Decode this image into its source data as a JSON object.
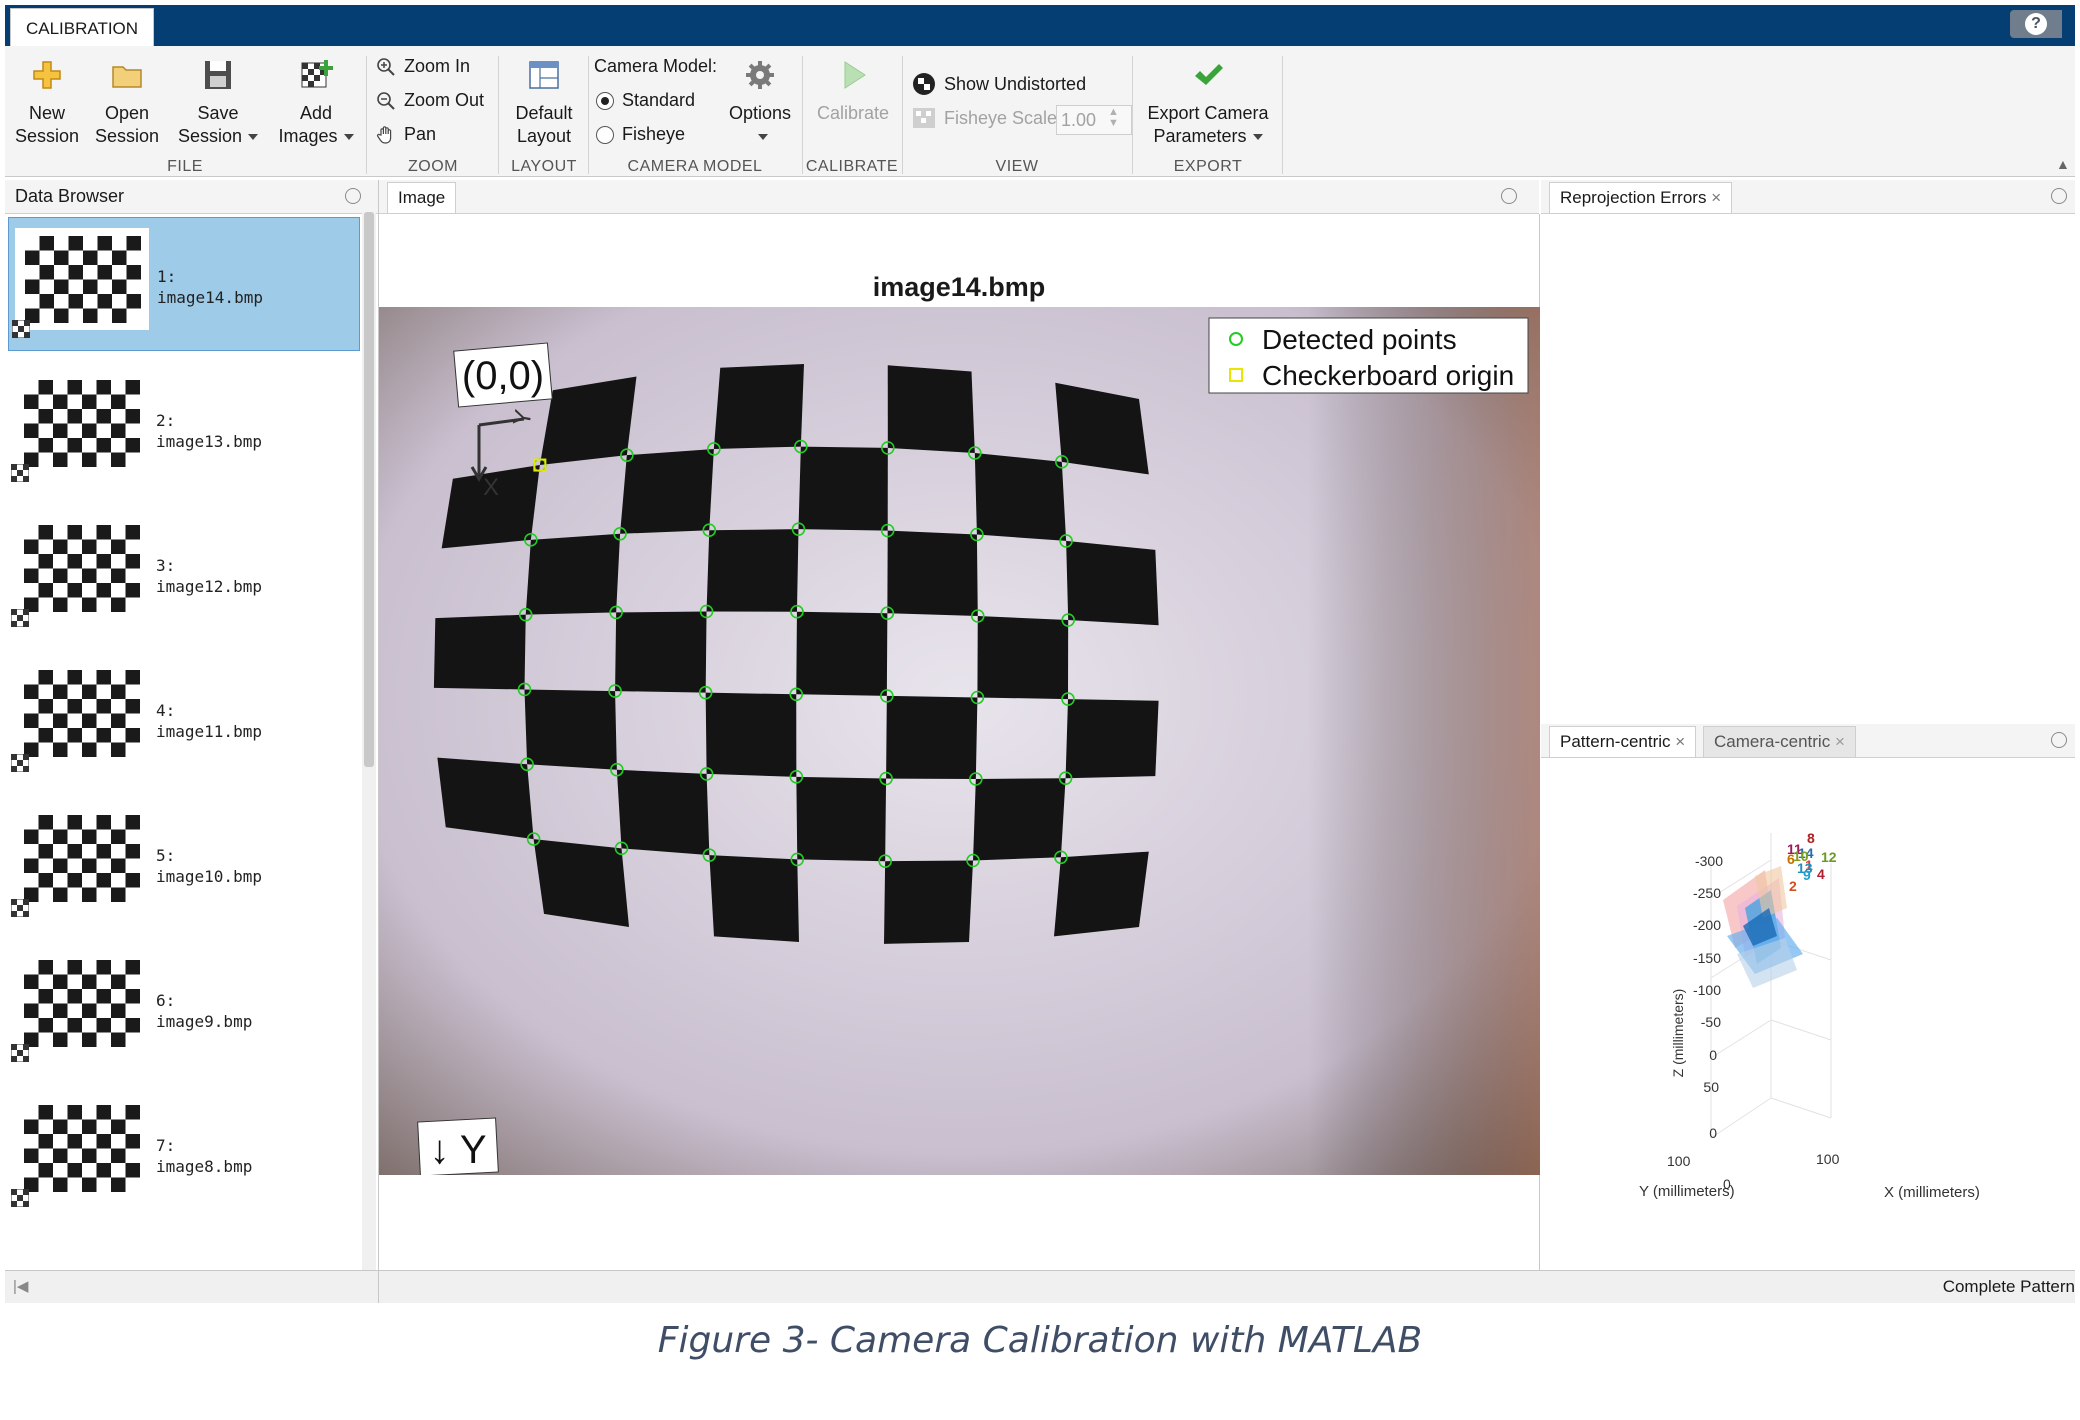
{
  "app": {
    "tab": "CALIBRATION",
    "help_icon": "?"
  },
  "ribbon": {
    "file": {
      "label": "FILE",
      "new_session": [
        "New",
        "Session"
      ],
      "open_session": [
        "Open",
        "Session"
      ],
      "save_session": [
        "Save",
        "Session"
      ],
      "add_images": [
        "Add",
        "Images"
      ]
    },
    "zoom": {
      "label": "ZOOM",
      "zoom_in": "Zoom In",
      "zoom_out": "Zoom Out",
      "pan": "Pan"
    },
    "layout": {
      "label": "LAYOUT",
      "default_layout": [
        "Default",
        "Layout"
      ]
    },
    "camera_model": {
      "label": "CAMERA MODEL",
      "title": "Camera Model:",
      "standard": "Standard",
      "fisheye": "Fisheye",
      "selected": "Standard",
      "options": "Options"
    },
    "calibrate": {
      "label": "CALIBRATE",
      "calibrate": "Calibrate"
    },
    "view": {
      "label": "VIEW",
      "show_undistorted": "Show Undistorted",
      "fisheye_scale": "Fisheye Scale",
      "fisheye_scale_value": "1.00"
    },
    "export": {
      "label": "EXPORT",
      "export_camera_parameters": [
        "Export Camera",
        "Parameters"
      ]
    }
  },
  "data_browser": {
    "title": "Data Browser",
    "items": [
      {
        "index": "1:",
        "name": "image14.bmp",
        "selected": true
      },
      {
        "index": "2:",
        "name": "image13.bmp",
        "selected": false
      },
      {
        "index": "3:",
        "name": "image12.bmp",
        "selected": false
      },
      {
        "index": "4:",
        "name": "image11.bmp",
        "selected": false
      },
      {
        "index": "5:",
        "name": "image10.bmp",
        "selected": false
      },
      {
        "index": "6:",
        "name": "image9.bmp",
        "selected": false
      },
      {
        "index": "7:",
        "name": "image8.bmp",
        "selected": false
      }
    ]
  },
  "image_panel": {
    "tab": "Image",
    "title": "image14.bmp",
    "origin_label": "(0,0)",
    "y_axis_label": "↓ Y",
    "small_y": "Y",
    "small_x": "X",
    "legend": {
      "detected": "Detected points",
      "origin": "Checkerboard origin",
      "detected_color": "#22cc22",
      "origin_color": "#e6e600"
    }
  },
  "reprojection_panel": {
    "tab": "Reprojection Errors"
  },
  "extrinsics_panel": {
    "tabs": [
      "Pattern-centric",
      "Camera-centric"
    ],
    "active_tab": "Pattern-centric",
    "z_label": "Z (millimeters)",
    "y_label": "Y (millimeters)",
    "x_label": "X (millimeters)",
    "z_ticks": [
      "-300",
      "-250",
      "-200",
      "-150",
      "-100",
      "-50",
      "0",
      "50",
      "0"
    ],
    "y_ticks": [
      "100"
    ],
    "x_ticks": [
      "100"
    ],
    "origin_tick": "0",
    "camera_labels": [
      {
        "text": "8",
        "color": "#b02020"
      },
      {
        "text": "11",
        "color": "#9a1a5a"
      },
      {
        "text": "14",
        "color": "#2a6ab0"
      },
      {
        "text": "6",
        "color": "#c87000"
      },
      {
        "text": "10",
        "color": "#7aa020"
      },
      {
        "text": "12",
        "color": "#6a9a20"
      },
      {
        "text": "1",
        "color": "#d04040"
      },
      {
        "text": "13",
        "color": "#2090c0"
      },
      {
        "text": "9",
        "color": "#20a0d0"
      },
      {
        "text": "4",
        "color": "#b02030"
      },
      {
        "text": "2",
        "color": "#d05020"
      }
    ]
  },
  "status": {
    "text": "Complete Pattern"
  },
  "caption": "Figure 3- Camera Calibration with MATLAB",
  "colors": {
    "title_band": "#053e72",
    "selection": "#9ecbe8"
  }
}
